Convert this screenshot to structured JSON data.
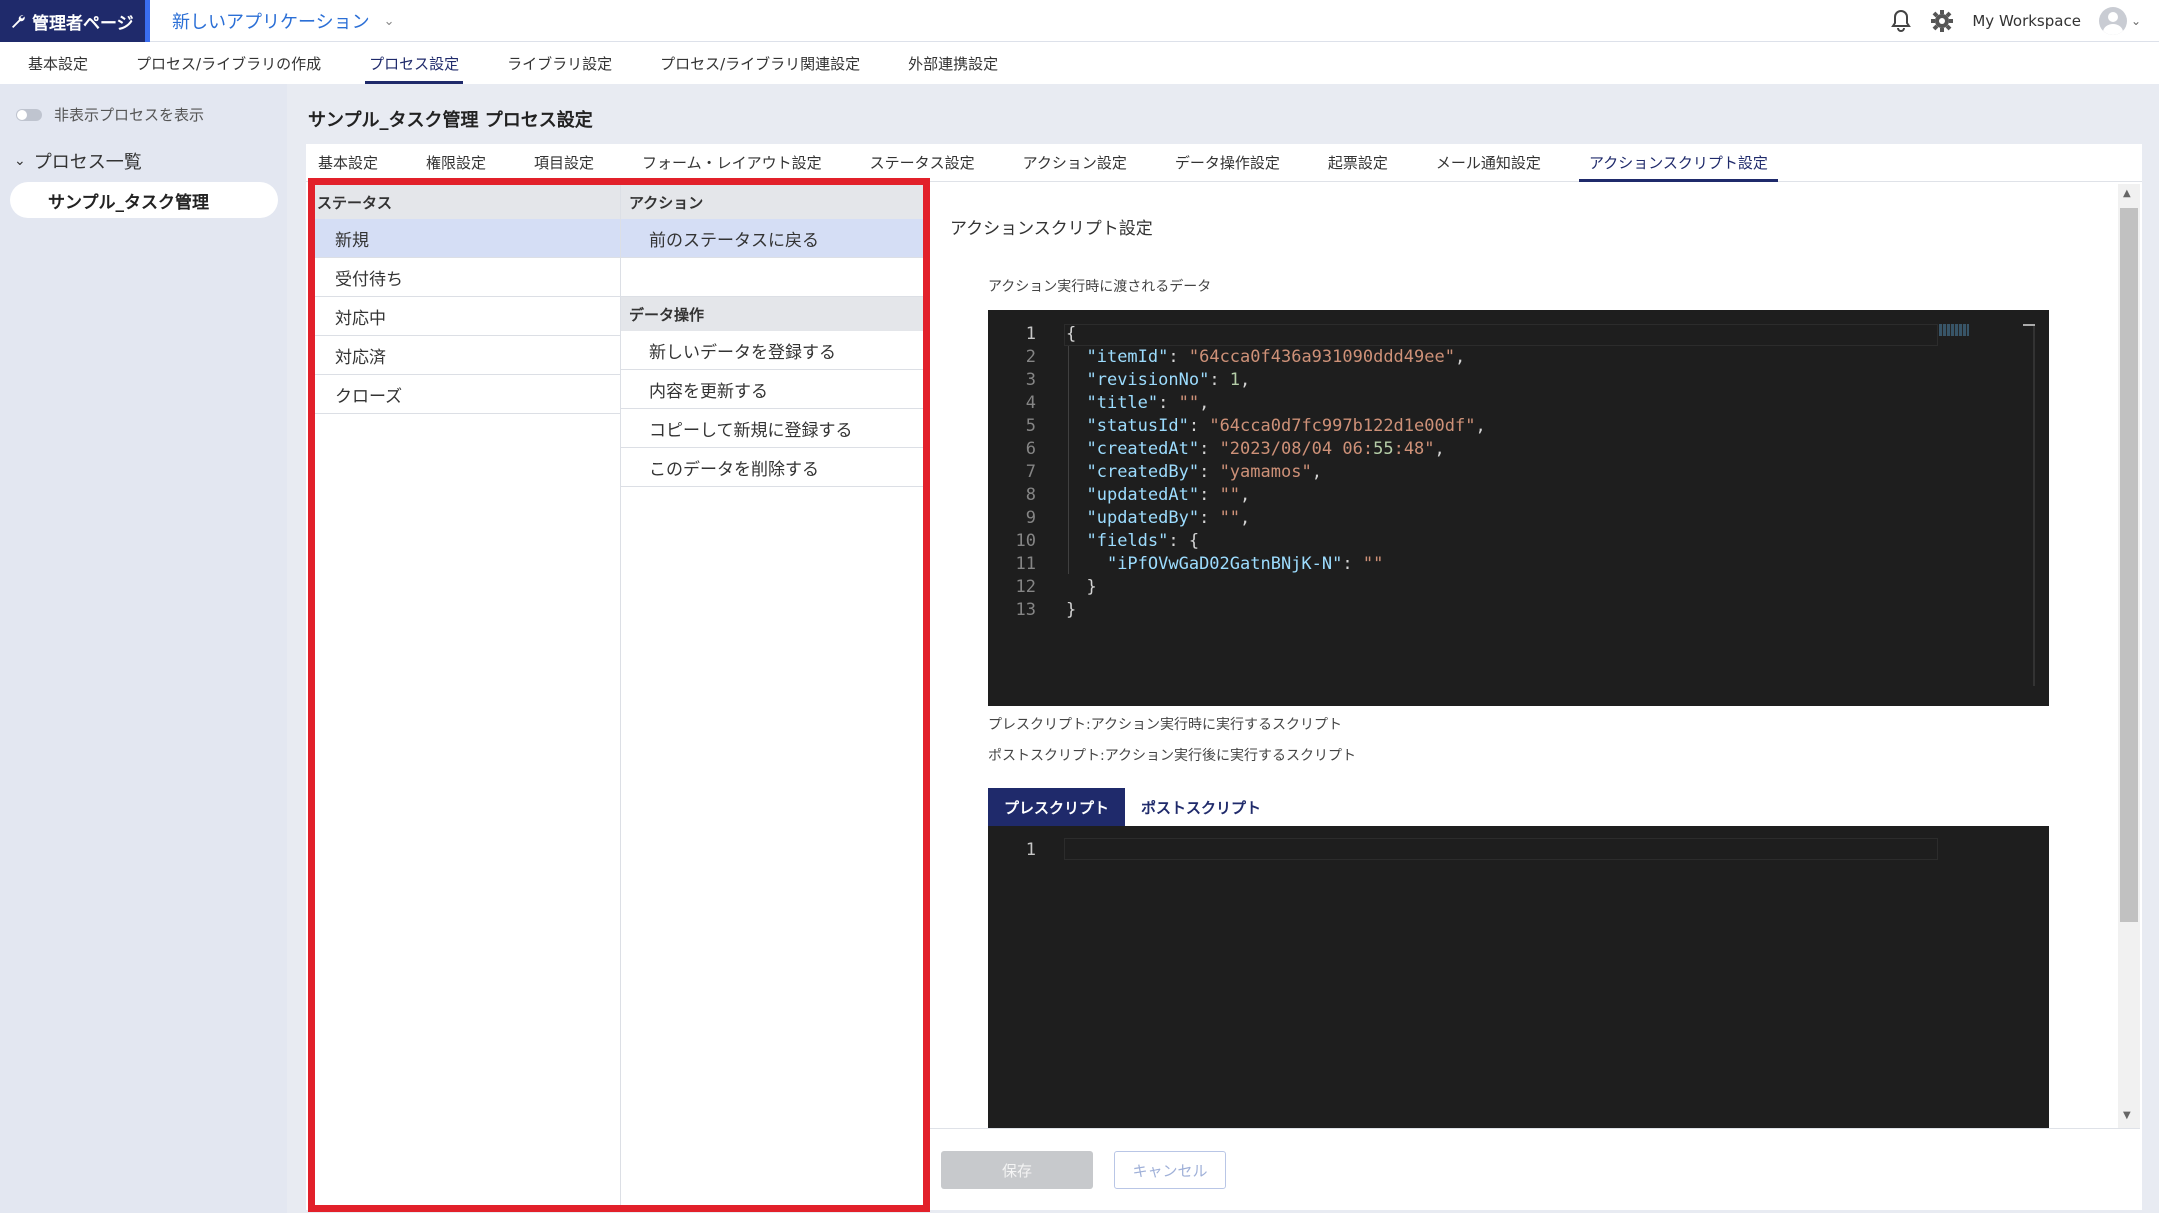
{
  "topbar": {
    "admin_label": "管理者ページ",
    "app_name": "新しいアプリケーション",
    "workspace": "My Workspace"
  },
  "main_nav": [
    "基本設定",
    "プロセス/ライブラリの作成",
    "プロセス設定",
    "ライブラリ設定",
    "プロセス/ライブラリ関連設定",
    "外部連携設定"
  ],
  "main_nav_active": "プロセス設定",
  "sidebar": {
    "toggle_label": "非表示プロセスを表示",
    "list_heading": "プロセス一覧",
    "items": [
      "サンプル_タスク管理"
    ]
  },
  "page_title": "サンプル_タスク管理 プロセス設定",
  "sub_tabs": [
    "基本設定",
    "権限設定",
    "項目設定",
    "フォーム・レイアウト設定",
    "ステータス設定",
    "アクション設定",
    "データ操作設定",
    "起票設定",
    "メール通知設定",
    "アクションスクリプト設定"
  ],
  "sub_tab_active": "アクションスクリプト設定",
  "status_panel": {
    "header": "ステータス",
    "items": [
      "新規",
      "受付待ち",
      "対応中",
      "対応済",
      "クローズ"
    ],
    "selected": "新規"
  },
  "action_panel": {
    "header": "アクション",
    "items": [
      "前のステータスに戻る"
    ],
    "data_ops_header": "データ操作",
    "data_ops": [
      "新しいデータを登録する",
      "内容を更新する",
      "コピーして新規に登録する",
      "このデータを削除する"
    ]
  },
  "editor": {
    "section_title": "アクションスクリプト設定",
    "data_label": "アクション実行時に渡されるデータ",
    "json_lines": [
      "{",
      "  \"itemId\": \"64cca0f436a931090ddd49ee\",",
      "  \"revisionNo\": 1,",
      "  \"title\": \"\",",
      "  \"statusId\": \"64cca0d7fc997b122d1e00df\",",
      "  \"createdAt\": \"2023/08/04 06:55:48\",",
      "  \"createdBy\": \"yamamos\",",
      "  \"updatedAt\": \"\",",
      "  \"updatedBy\": \"\",",
      "  \"fields\": {",
      "    \"iPfOVwGaD02GatnBNjK-N\": \"\"",
      "  }",
      "}"
    ],
    "pre_desc": "プレスクリプト:アクション実行時に実行するスクリプト",
    "post_desc": "ポストスクリプト:アクション実行後に実行するスクリプト",
    "tab_pre": "プレスクリプト",
    "tab_post": "ポストスクリプト",
    "script_line": "1"
  },
  "footer": {
    "save": "保存",
    "cancel": "キャンセル"
  },
  "colors": {
    "brand_navy": "#1f2a6b",
    "highlight_red": "#e2202a",
    "selected_row": "#d5def5",
    "editor_bg": "#1e1e1e"
  }
}
